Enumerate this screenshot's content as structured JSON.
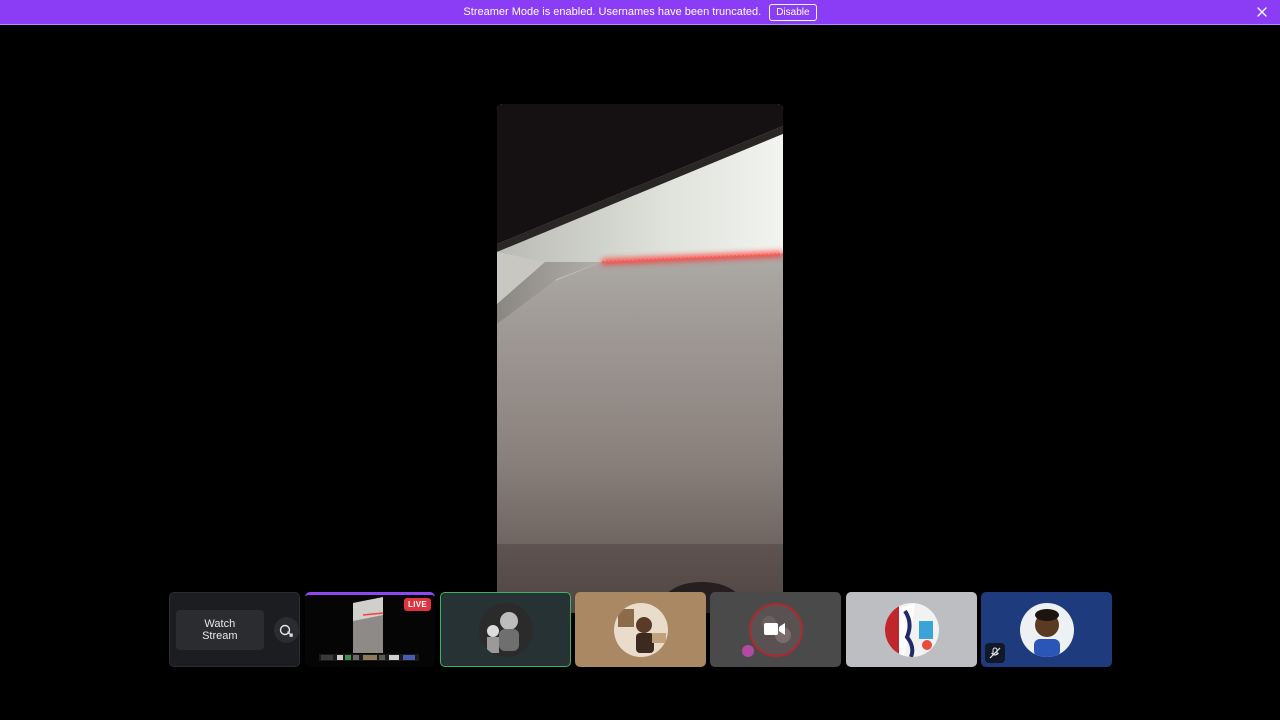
{
  "notice": {
    "message": "Streamer Mode is enabled. Usernames have been truncated.",
    "disable_label": "Disable"
  },
  "stage": {
    "watch_label": "Watch Stream",
    "live_label": "LIVE"
  },
  "colors": {
    "notice_bg": "#8b3cf5",
    "live_red": "#e0333e",
    "speaking_green": "#3bb65d",
    "stream_accent": "#8f47f0"
  },
  "icons": {
    "close": "close-icon",
    "popout": "popout-icon",
    "camera_off": "camera-off-icon",
    "mute": "mute-icon"
  }
}
